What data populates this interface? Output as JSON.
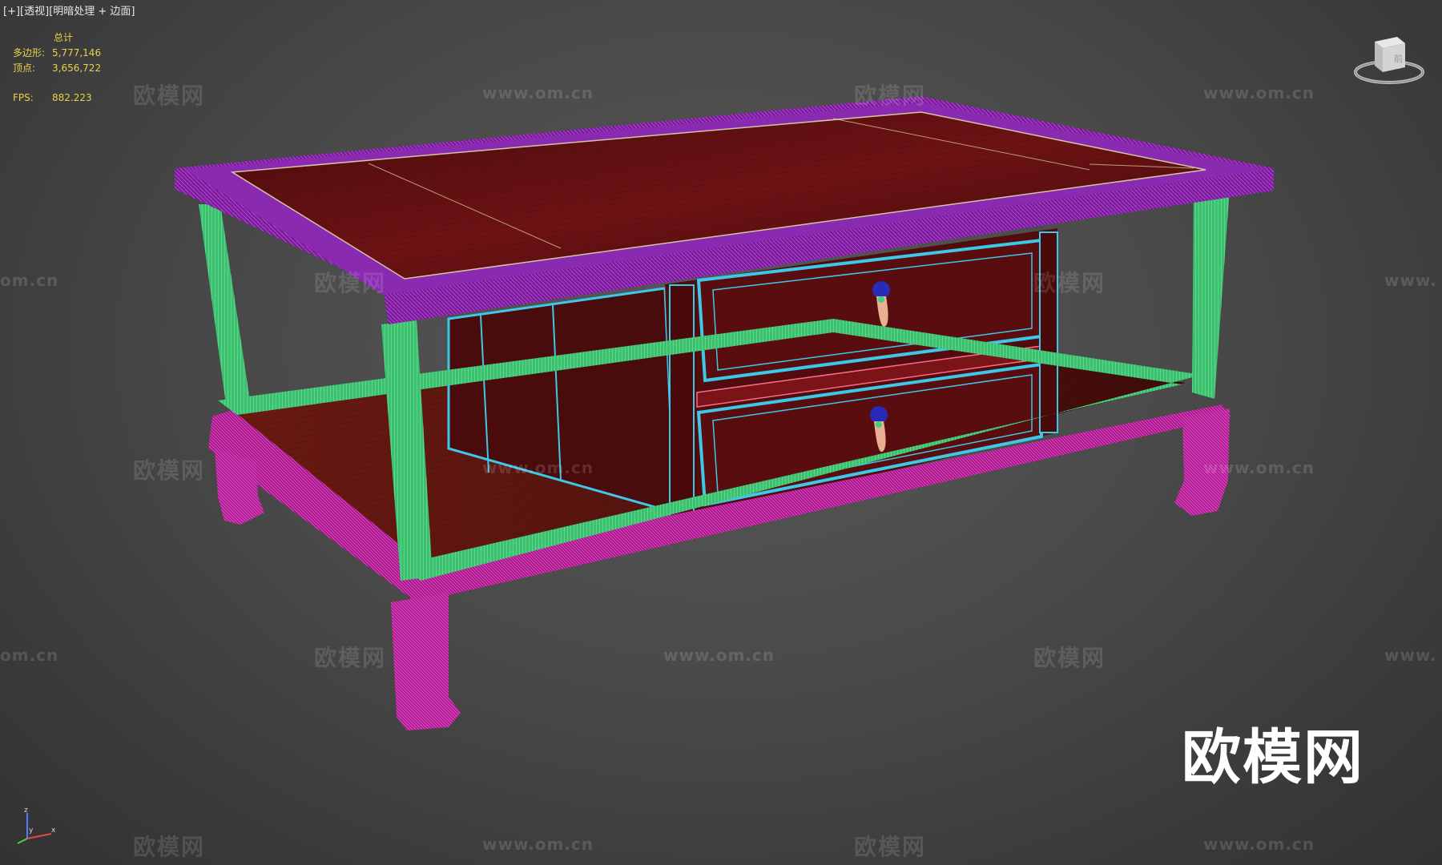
{
  "viewport": {
    "label_plus": "[+]",
    "label_view": "[透视]",
    "label_shading": "[明暗处理 + 边面]"
  },
  "stats": {
    "header": "总计",
    "polys_label": "多边形:",
    "polys_value": "5,777,146",
    "verts_label": "顶点:",
    "verts_value": "3,656,722",
    "fps_label": "FPS:",
    "fps_value": "882.223"
  },
  "watermark": {
    "text": "欧模网",
    "url": "www.om.cn",
    "url_cut": "om.cn",
    "url_cut_right": "www."
  },
  "logo": {
    "text": "欧模网"
  },
  "icons": {
    "viewcube": "viewcube-icon",
    "axis": "axis-tripod-icon",
    "handle": "drawer-handle-icon"
  },
  "colors": {
    "background": "#4a4a4a",
    "stats_text": "#e8d24a",
    "wood": "#5c0f10",
    "frame_wire": "#7a1e9c",
    "leg_wire": "#4fe08a",
    "base_wire": "#c0239c",
    "drawer_wire": "#3ec8e8"
  }
}
